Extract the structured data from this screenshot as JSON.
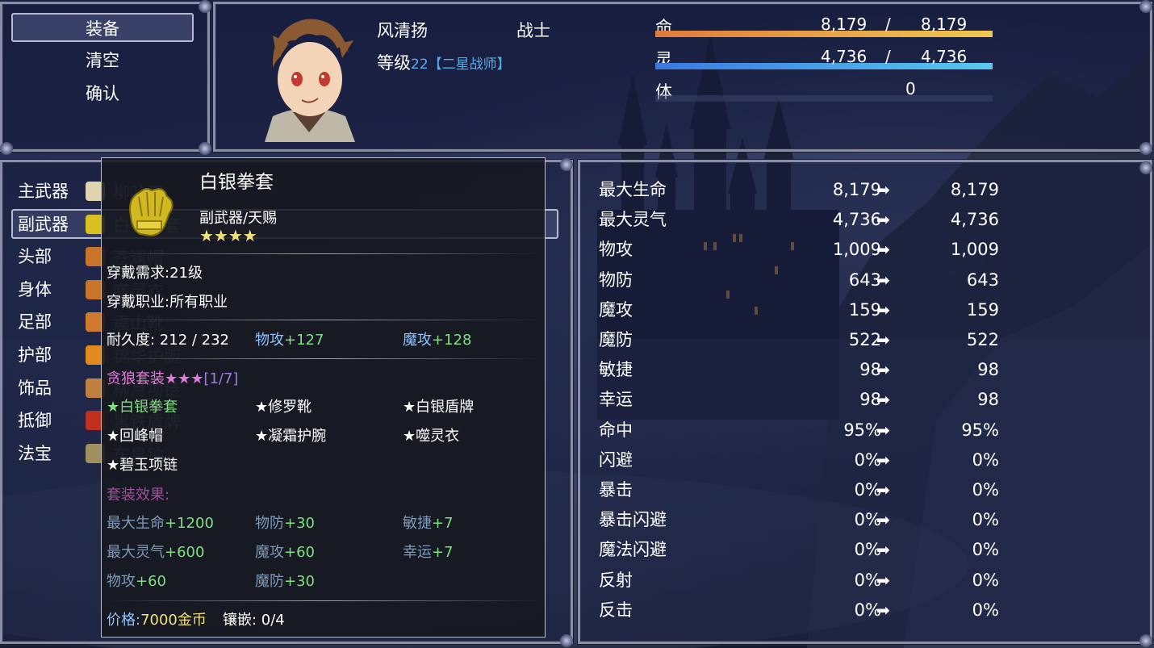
{
  "command_menu": {
    "items": [
      "装备",
      "清空",
      "确认"
    ],
    "selected_index": 0
  },
  "actor": {
    "name": "风清扬",
    "class": "战士",
    "level_label": "等级",
    "level": "22",
    "title": "【二星战师】",
    "hp_label": "命",
    "hp": "8,179",
    "hp_max": "8,179",
    "mp_label": "灵",
    "mp": "4,736",
    "mp_max": "4,736",
    "tp_label": "体",
    "tp": "0",
    "slash": "/",
    "hp_fraction": 1.0,
    "mp_fraction": 1.0,
    "hp_color": "#f0a23c",
    "mp_color": "#3aa8e8"
  },
  "slots": [
    {
      "label": "主武器",
      "item": "柳叶刀",
      "icon": "curved-blade-icon",
      "color": "#e0d4b0"
    },
    {
      "label": "副武器",
      "item": "白银拳套",
      "icon": "gauntlet-icon",
      "color": "#d8c020"
    },
    {
      "label": "头部",
      "item": "苍澜帽",
      "icon": "helmet-icon",
      "color": "#c8742a"
    },
    {
      "label": "身体",
      "item": "噬灵衣",
      "icon": "armor-icon",
      "color": "#c8742a"
    },
    {
      "label": "足部",
      "item": "震山靴",
      "icon": "boots-icon",
      "color": "#d07a30"
    },
    {
      "label": "护部",
      "item": "锦华护腕",
      "icon": "bracer-icon",
      "color": "#e08a20"
    },
    {
      "label": "饰品",
      "item": "柳月项链",
      "icon": "necklace-icon",
      "color": "#c08040"
    },
    {
      "label": "抵御",
      "item": "黑铁盾牌",
      "icon": "shield-icon",
      "color": "#c03020"
    },
    {
      "label": "法宝",
      "item": "东皇钟",
      "icon": "bell-icon",
      "color": "#a09060"
    }
  ],
  "tooltip": {
    "item_name": "白银拳套",
    "item_type": "副武器/天赐",
    "stars": "★★★★",
    "requirement": "穿戴需求:21级",
    "job": "穿戴职业:所有职业",
    "durability": "耐久度: 212 / 232",
    "bonus1_label": "物攻",
    "bonus1_value": "+127",
    "bonus2_label": "魔攻",
    "bonus2_value": "+128",
    "set_name": "贪狼套装★★★",
    "set_count": "[1/7]",
    "set_items": [
      {
        "name": "★白银拳套",
        "owned": true
      },
      {
        "name": "★修罗靴",
        "owned": false
      },
      {
        "name": "★白银盾牌",
        "owned": false
      },
      {
        "name": "★回峰帽",
        "owned": false
      },
      {
        "name": "★凝霜护腕",
        "owned": false
      },
      {
        "name": "★噬灵衣",
        "owned": false
      },
      {
        "name": "★碧玉项链",
        "owned": false
      }
    ],
    "set_effect_label": "套装效果:",
    "set_effects": [
      {
        "label": "最大生命",
        "value": "+1200"
      },
      {
        "label": "物防",
        "value": "+30"
      },
      {
        "label": "敏捷",
        "value": "+7"
      },
      {
        "label": "最大灵气",
        "value": "+600"
      },
      {
        "label": "魔攻",
        "value": "+60"
      },
      {
        "label": "幸运",
        "value": "+7"
      },
      {
        "label": "物攻",
        "value": "+60"
      },
      {
        "label": "魔防",
        "value": "+30"
      }
    ],
    "price_label": "价格:",
    "price_value": "7000金币",
    "socket": "镶嵌: 0/4"
  },
  "stats": [
    {
      "name": "最大生命",
      "current": "8,179",
      "new": "8,179"
    },
    {
      "name": "最大灵气",
      "current": "4,736",
      "new": "4,736"
    },
    {
      "name": "物攻",
      "current": "1,009",
      "new": "1,009"
    },
    {
      "name": "物防",
      "current": "643",
      "new": "643"
    },
    {
      "name": "魔攻",
      "current": "159",
      "new": "159"
    },
    {
      "name": "魔防",
      "current": "522",
      "new": "522"
    },
    {
      "name": "敏捷",
      "current": "98",
      "new": "98"
    },
    {
      "name": "幸运",
      "current": "98",
      "new": "98"
    },
    {
      "name": "命中",
      "current": "95%",
      "new": "95%"
    },
    {
      "name": "闪避",
      "current": "0%",
      "new": "0%"
    },
    {
      "name": "暴击",
      "current": "0%",
      "new": "0%"
    },
    {
      "name": "暴击闪避",
      "current": "0%",
      "new": "0%"
    },
    {
      "name": "魔法闪避",
      "current": "0%",
      "new": "0%"
    },
    {
      "name": "反射",
      "current": "0%",
      "new": "0%"
    },
    {
      "name": "反击",
      "current": "0%",
      "new": "0%"
    }
  ],
  "arrow_glyph": "➡"
}
